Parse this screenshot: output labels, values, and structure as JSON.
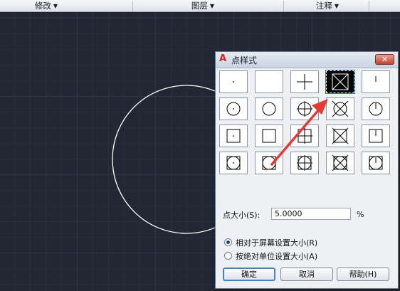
{
  "ribbon": {
    "groups": [
      {
        "label": "修改"
      },
      {
        "label": "图层"
      },
      {
        "label": "注释"
      }
    ]
  },
  "dialog": {
    "title": "点样式",
    "app_icon_glyph": "A",
    "close_glyph": "✕",
    "point_styles": {
      "rows": 4,
      "cols": 5,
      "selected_index": 3,
      "base_marks": [
        "dot",
        "none",
        "plus",
        "x",
        "tick"
      ],
      "row_frames": [
        "plain",
        "circle",
        "square",
        "circle-square"
      ]
    },
    "size_label": "点大小(S):",
    "size_value": "5.0000",
    "size_unit": "%",
    "options": [
      {
        "label": "相对于屏幕设置大小(R)",
        "checked": true
      },
      {
        "label": "按绝对单位设置大小(A)",
        "checked": false
      }
    ],
    "buttons": {
      "ok": "确定",
      "cancel": "取消",
      "help": "帮助(H)"
    }
  },
  "colors": {
    "canvas_bg": "#212733",
    "circle": "#ffffff",
    "arrow": "#e53935",
    "close_button": "#c4432f"
  }
}
